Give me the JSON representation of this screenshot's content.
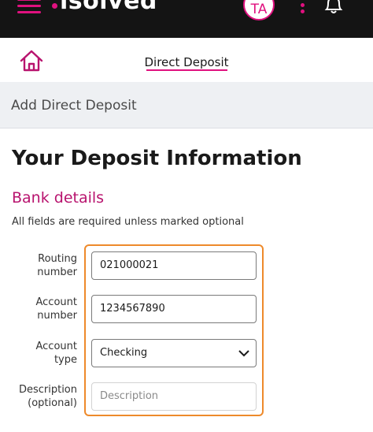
{
  "topbar": {
    "logo": "isolved",
    "avatar_initials": "TA",
    "icons": [
      "menu-icon",
      "kebab-menu-icon",
      "bell-icon"
    ]
  },
  "navbar": {
    "title": "Direct Deposit",
    "home_icon": "home-icon"
  },
  "section_header": "Add Direct Deposit",
  "main_title": "Your Deposit Information",
  "bank_details": {
    "title": "Bank details",
    "note": "All fields are required unless marked optional"
  },
  "form": {
    "routing": {
      "label_line1": "Routing",
      "label_line2": "number",
      "value": "021000021"
    },
    "account": {
      "label_line1": "Account",
      "label_line2": "number",
      "value": "1234567890"
    },
    "account_type": {
      "label_line1": "Account",
      "label_line2": "type",
      "value": "Checking"
    },
    "description": {
      "label_line1": "Description",
      "label_line2": "(optional)",
      "placeholder": "Description"
    }
  },
  "colors": {
    "brand": "#e0117f",
    "topbar": "#141414",
    "highlight": "#ee8a2b"
  }
}
